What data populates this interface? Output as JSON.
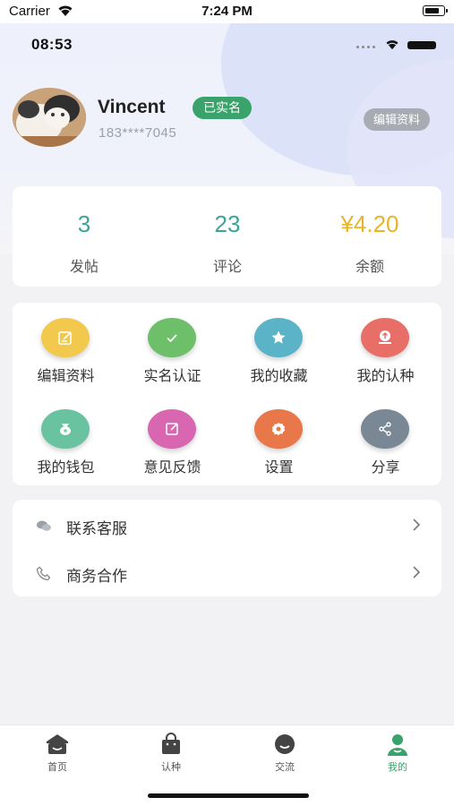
{
  "outer_status": {
    "carrier": "Carrier",
    "time": "7:24 PM"
  },
  "inner_status": {
    "time": "08:53"
  },
  "profile": {
    "name": "Vincent",
    "verified_badge": "已实名",
    "phone": "183****7045",
    "edit_button": "编辑资料"
  },
  "stats": [
    {
      "value": "3",
      "label": "发帖",
      "color": "#3aa596"
    },
    {
      "value": "23",
      "label": "评论",
      "color": "#3aa596"
    },
    {
      "value": "¥4.20",
      "label": "余额",
      "color": "#e6b52c"
    }
  ],
  "grid": [
    {
      "label": "编辑资料",
      "icon": "edit-icon",
      "color": "#f2c94c"
    },
    {
      "label": "实名认证",
      "icon": "check-icon",
      "color": "#6dbf6a"
    },
    {
      "label": "我的收藏",
      "icon": "star-icon",
      "color": "#5bb3c8"
    },
    {
      "label": "我的认种",
      "icon": "seedling-icon",
      "color": "#e76f67"
    },
    {
      "label": "我的钱包",
      "icon": "wallet-icon",
      "color": "#69c2a0"
    },
    {
      "label": "意见反馈",
      "icon": "feedback-icon",
      "color": "#d966b0"
    },
    {
      "label": "设置",
      "icon": "gear-icon",
      "color": "#e8774a"
    },
    {
      "label": "分享",
      "icon": "share-icon",
      "color": "#7a8794"
    }
  ],
  "menu": [
    {
      "label": "联系客服",
      "icon": "wechat-icon"
    },
    {
      "label": "商务合作",
      "icon": "phone-icon"
    }
  ],
  "tabs": [
    {
      "label": "首页",
      "icon": "home-icon",
      "active": false
    },
    {
      "label": "认种",
      "icon": "bag-icon",
      "active": false
    },
    {
      "label": "交流",
      "icon": "chat-icon",
      "active": false
    },
    {
      "label": "我的",
      "icon": "user-icon",
      "active": true
    }
  ],
  "colors": {
    "accent_green": "#3aa36b",
    "teal_value": "#3aa596",
    "gold_value": "#e6b52c"
  }
}
